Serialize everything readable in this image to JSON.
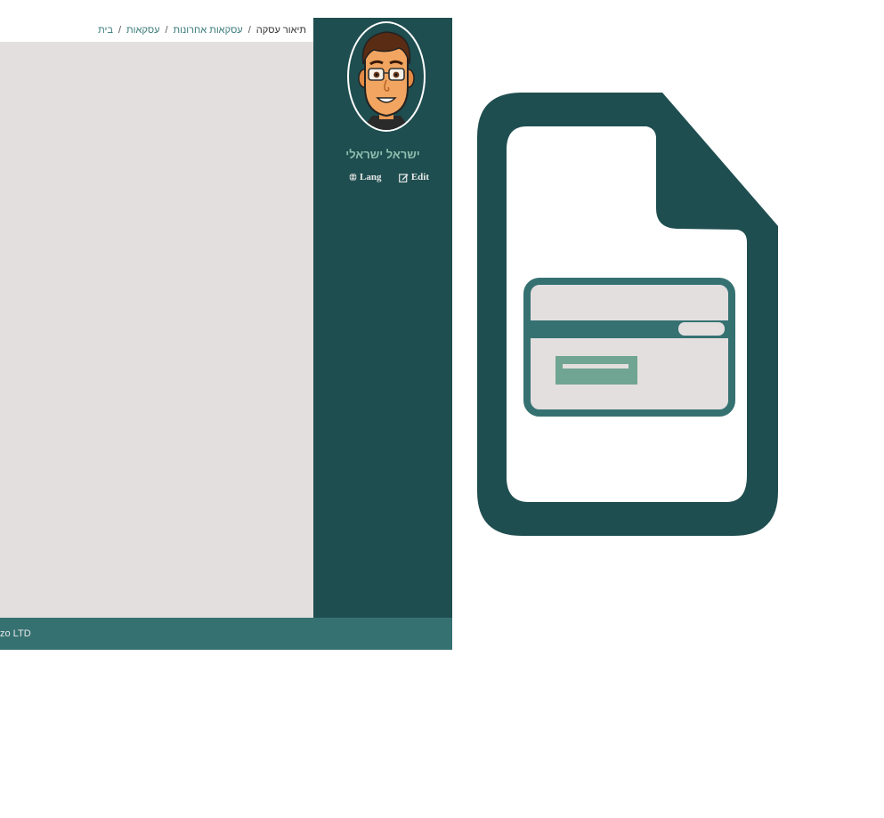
{
  "breadcrumb": {
    "items": [
      "בית",
      "עסקאות",
      "עסקאות אחרונות"
    ],
    "current": "תיאור עסקה",
    "separator": "/"
  },
  "sidebar": {
    "user_name": "ישראל ישראלי",
    "lang_label": "Lang",
    "edit_label": "Edit"
  },
  "footer": {
    "text": "zo LTD"
  },
  "colors": {
    "sidebar_bg": "#1f4e50",
    "footer_bg": "#367172",
    "content_bg": "#e4dfdf",
    "accent": "#6fa592"
  },
  "icons": {
    "lang": "globe-icon",
    "edit": "edit-icon",
    "large": "document-credit-card-icon"
  }
}
